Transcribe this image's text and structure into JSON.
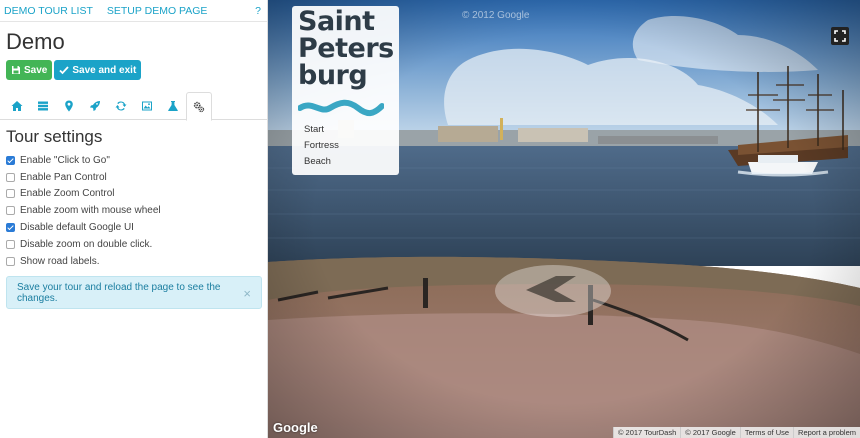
{
  "topnav": {
    "demo_tour_list": "DEMO TOUR LIST",
    "setup_demo_page": "SETUP DEMO PAGE",
    "help": "?"
  },
  "page_title": "Demo",
  "actions": {
    "save": "Save",
    "save_exit": "Save and exit"
  },
  "tabs": [
    "home-icon",
    "list-icon",
    "map-marker-icon",
    "rocket-icon",
    "refresh-icon",
    "image-icon",
    "flask-icon",
    "cogs-icon"
  ],
  "active_tab": "cogs-icon",
  "settings": {
    "title": "Tour settings",
    "options": [
      {
        "label": "Enable \"Click to Go\"",
        "checked": true
      },
      {
        "label": "Enable Pan Control",
        "checked": false
      },
      {
        "label": "Enable Zoom Control",
        "checked": false
      },
      {
        "label": "Enable zoom with mouse wheel",
        "checked": false
      },
      {
        "label": "Disable default Google UI",
        "checked": true
      },
      {
        "label": "Disable zoom on double click.",
        "checked": false
      },
      {
        "label": "Show road labels.",
        "checked": false
      }
    ]
  },
  "alert": {
    "text": "Save your tour and reload the page to see the changes.",
    "close": "×"
  },
  "viewer": {
    "copyright_top": "© 2012 Google",
    "logo_lines": [
      "Saint",
      "Peters",
      "burg"
    ],
    "menu": [
      "Start",
      "Fortress",
      "Beach"
    ],
    "google_logo": "Google",
    "footer": [
      "© 2017 TourDash",
      "© 2017 Google",
      "Terms of Use",
      "Report a problem"
    ]
  },
  "colors": {
    "accent": "#1ba3c8",
    "save_green": "#43b556",
    "logo_wave": "#3aa7c4",
    "logo_text": "#2e3c47"
  }
}
